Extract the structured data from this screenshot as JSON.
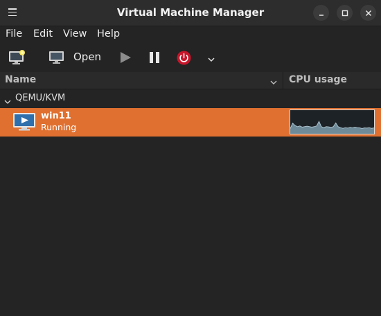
{
  "window": {
    "title": "Virtual Machine Manager"
  },
  "menu": [
    "File",
    "Edit",
    "View",
    "Help"
  ],
  "toolbar": {
    "open_label": "Open"
  },
  "columns": {
    "name": "Name",
    "cpu": "CPU usage"
  },
  "groups": [
    {
      "label": "QEMU/KVM",
      "vms": [
        {
          "name": "win11",
          "status": "Running",
          "selected": true,
          "cpu_history": [
            0.22,
            0.45,
            0.35,
            0.3,
            0.33,
            0.28,
            0.3,
            0.32,
            0.3,
            0.28,
            0.3,
            0.33,
            0.52,
            0.3,
            0.26,
            0.3,
            0.29,
            0.27,
            0.3,
            0.46,
            0.3,
            0.26,
            0.23,
            0.26,
            0.24,
            0.27,
            0.25,
            0.28,
            0.26,
            0.25,
            0.22,
            0.25,
            0.24,
            0.26,
            0.23,
            0.25
          ]
        }
      ]
    }
  ],
  "colors": {
    "selection": "#e0702f",
    "power_button": "#c7162b",
    "window_bg": "#242424",
    "header_bg": "#2d2d2d"
  },
  "icons": [
    "hamburger-menu-icon",
    "new-vm-icon",
    "monitor-icon",
    "play-icon",
    "pause-icon",
    "power-icon",
    "chevron-down-icon",
    "vm-display-icon",
    "minimize-icon",
    "maximize-icon",
    "close-icon"
  ]
}
